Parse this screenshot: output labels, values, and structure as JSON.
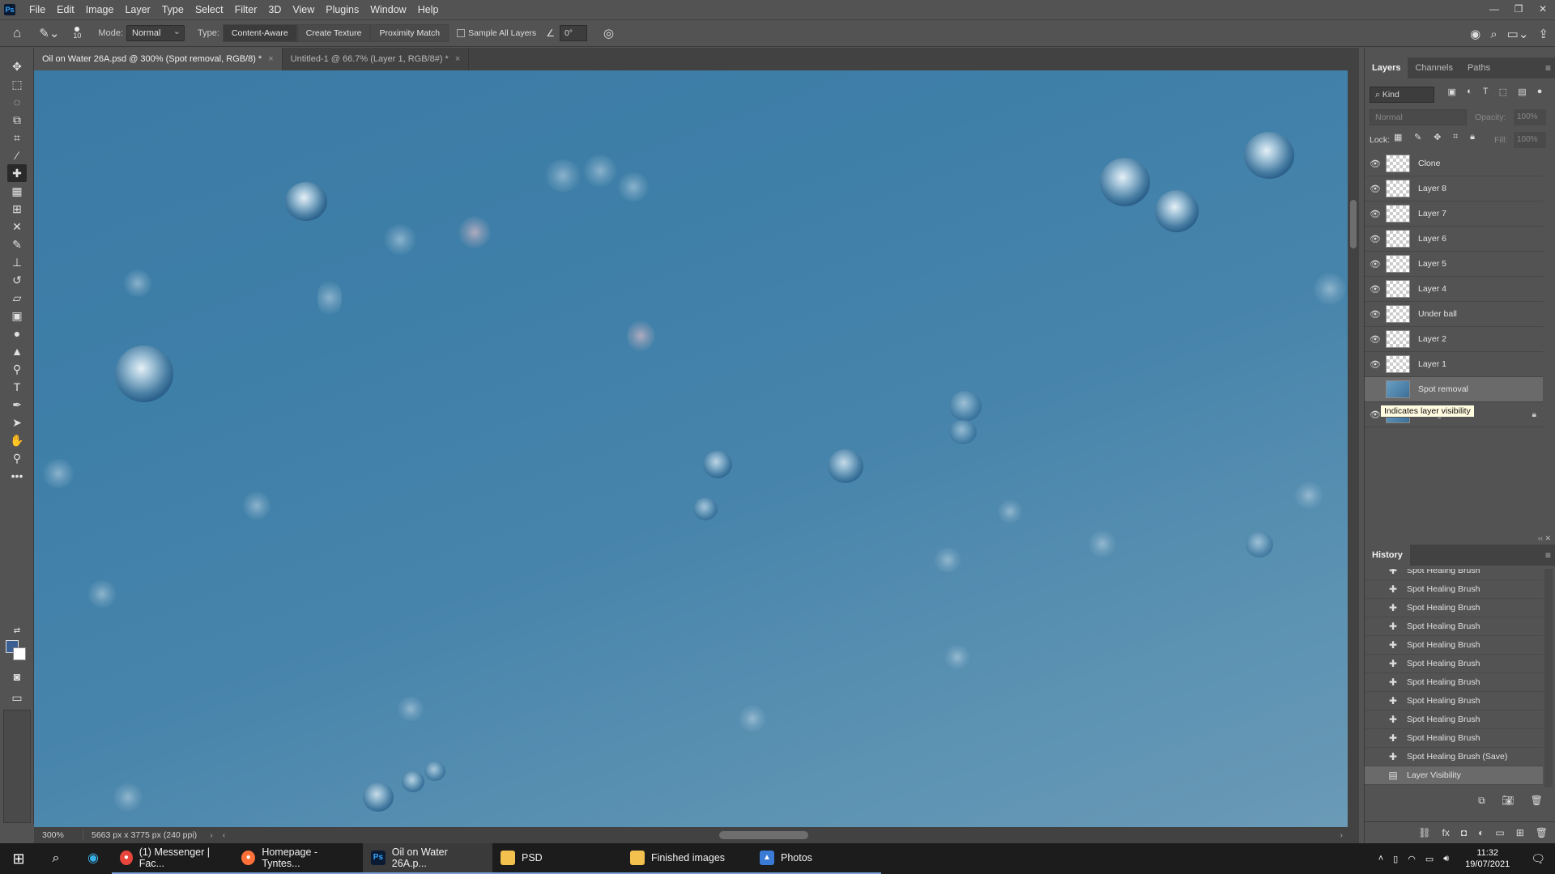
{
  "menubar": {
    "logo": "Ps",
    "items": [
      "File",
      "Edit",
      "Image",
      "Layer",
      "Type",
      "Select",
      "Filter",
      "3D",
      "View",
      "Plugins",
      "Window",
      "Help"
    ],
    "window_controls": [
      "—",
      "❐",
      "✕"
    ]
  },
  "options": {
    "brush_size": "10",
    "mode_label": "Mode:",
    "mode_value": "Normal",
    "type_label": "Type:",
    "type_buttons": [
      "Content-Aware",
      "Create Texture",
      "Proximity Match"
    ],
    "sample_all_layers": "Sample All Layers",
    "angle": "0°"
  },
  "tabs": [
    {
      "label": "Oil on Water 26A.psd @ 300% (Spot removal, RGB/8) *",
      "close": "×"
    },
    {
      "label": "Untitled-1 @ 66.7% (Layer 1, RGB/8#) *",
      "close": "×"
    }
  ],
  "status": {
    "zoom": "300%",
    "doc_info": "5663 px x 3775 px (240 ppi)"
  },
  "layers_panel": {
    "tabs": [
      "Layers",
      "Channels",
      "Paths"
    ],
    "filter_kind": "Kind",
    "blend_mode": "Normal",
    "opacity_label": "Opacity:",
    "opacity_value": "100%",
    "lock_label": "Lock:",
    "fill_label": "Fill:",
    "fill_value": "100%",
    "layers": [
      {
        "name": "Clone",
        "visible": true
      },
      {
        "name": "Layer 8",
        "visible": true
      },
      {
        "name": "Layer 7",
        "visible": true
      },
      {
        "name": "Layer 6",
        "visible": true
      },
      {
        "name": "Layer 5",
        "visible": true
      },
      {
        "name": "Layer 4",
        "visible": true
      },
      {
        "name": "Under ball",
        "visible": true
      },
      {
        "name": "Layer 2",
        "visible": true
      },
      {
        "name": "Layer 1",
        "visible": true
      },
      {
        "name": "Spot removal",
        "visible": false
      },
      {
        "name": "Background",
        "visible": true
      }
    ],
    "tooltip": "Indicates layer visibility"
  },
  "history_panel": {
    "title": "History",
    "items": [
      "Spot Healing Brush",
      "Spot Healing Brush",
      "Spot Healing Brush",
      "Spot Healing Brush",
      "Spot Healing Brush",
      "Spot Healing Brush",
      "Spot Healing Brush",
      "Spot Healing Brush",
      "Spot Healing Brush",
      "Spot Healing Brush",
      "Spot Healing Brush (Save)",
      "Layer Visibility"
    ]
  },
  "taskbar": {
    "apps": [
      {
        "label": "(1) Messenger | Fac...",
        "icon": "chrome-icon",
        "color": "#e8453c"
      },
      {
        "label": "Homepage - Tyntes...",
        "icon": "firefox-icon",
        "color": "#ff7139"
      },
      {
        "label": "Oil on Water 26A.p...",
        "icon": "photoshop-icon",
        "color": "#31a8ff"
      },
      {
        "label": "PSD",
        "icon": "folder-icon",
        "color": "#f2c14e"
      },
      {
        "label": "Finished images",
        "icon": "folder-icon",
        "color": "#f2c14e"
      },
      {
        "label": "Photos",
        "icon": "photos-icon",
        "color": "#3a7bd5"
      }
    ],
    "time": "11:32",
    "date": "19/07/2021"
  },
  "colors": {
    "accent": "#31a8ff",
    "foreground_swatch": "#3b5f93",
    "background_swatch": "#ffffff"
  }
}
